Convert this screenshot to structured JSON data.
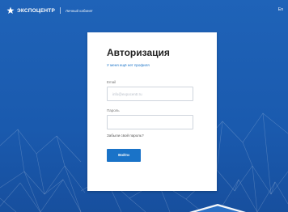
{
  "header": {
    "brand": "ЭКСПОЦЕНТР",
    "section": "Личный кабинет",
    "lang": "En"
  },
  "login": {
    "title": "Авторизация",
    "register_link": "У меня ещё нет профиля",
    "email_label": "Email",
    "email_placeholder": "info@expocentr.ru",
    "email_value": "",
    "password_label": "Пароль",
    "password_value": "",
    "forgot_link": "Забыли свой пароль?",
    "submit_label": "Войти"
  },
  "colors": {
    "background": "#1d5fb3",
    "accent": "#1a73c8",
    "card": "#ffffff"
  },
  "icons": {
    "logo": "star-logo-icon"
  }
}
